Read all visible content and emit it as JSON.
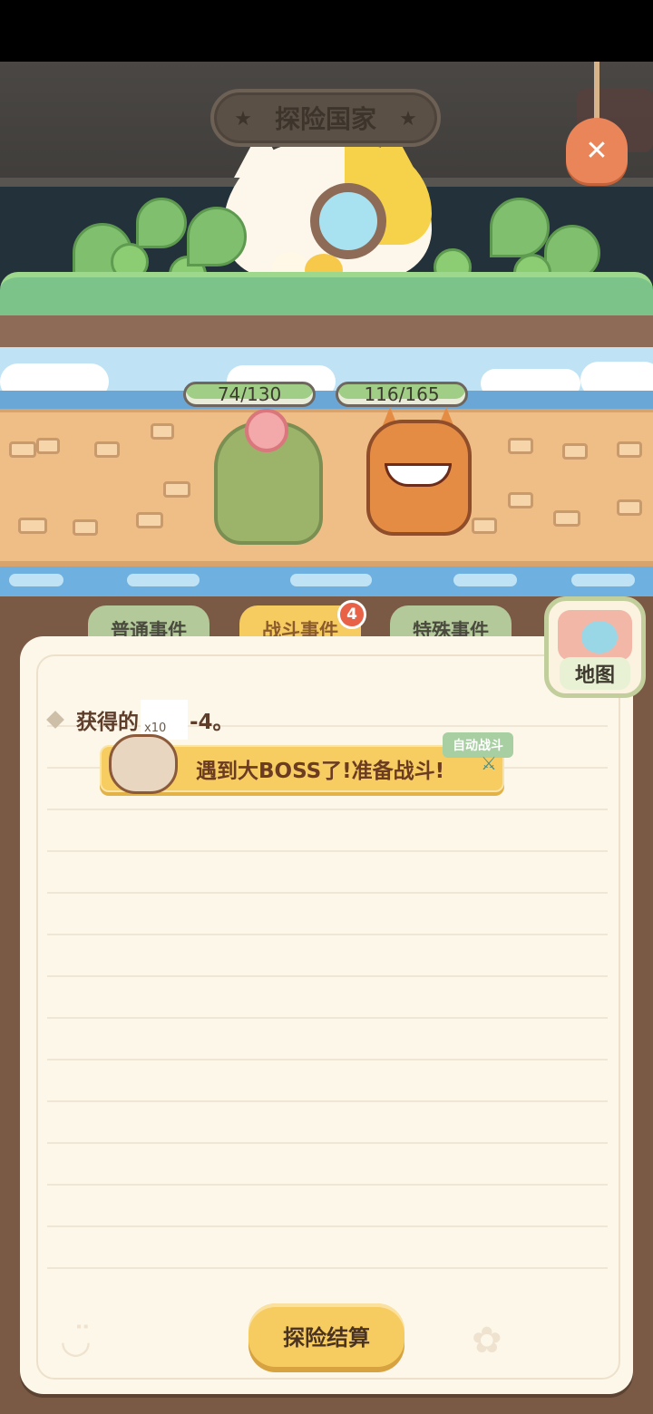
{
  "banner": {
    "title": "探险国家",
    "close_icon": "close-icon"
  },
  "battle": {
    "player_hp": "74/130",
    "enemy_hp": "116/165"
  },
  "tabs": [
    {
      "label": "普通事件",
      "active": false
    },
    {
      "label": "战斗事件",
      "active": true,
      "badge": "4"
    },
    {
      "label": "特殊事件",
      "active": false
    }
  ],
  "map_button": {
    "label": "地图"
  },
  "log": {
    "prefix": "获得的",
    "item_count": "x10",
    "suffix": "-4。"
  },
  "event": {
    "text": "遇到大BOSS了!准备战斗!",
    "auto_label": "自动战斗"
  },
  "footer": {
    "settle_label": "探险结算"
  },
  "colors": {
    "accent": "#f6cc61",
    "hp_fill": "#a0ce86",
    "badge": "#e86248",
    "panel": "#fdf7ea"
  }
}
